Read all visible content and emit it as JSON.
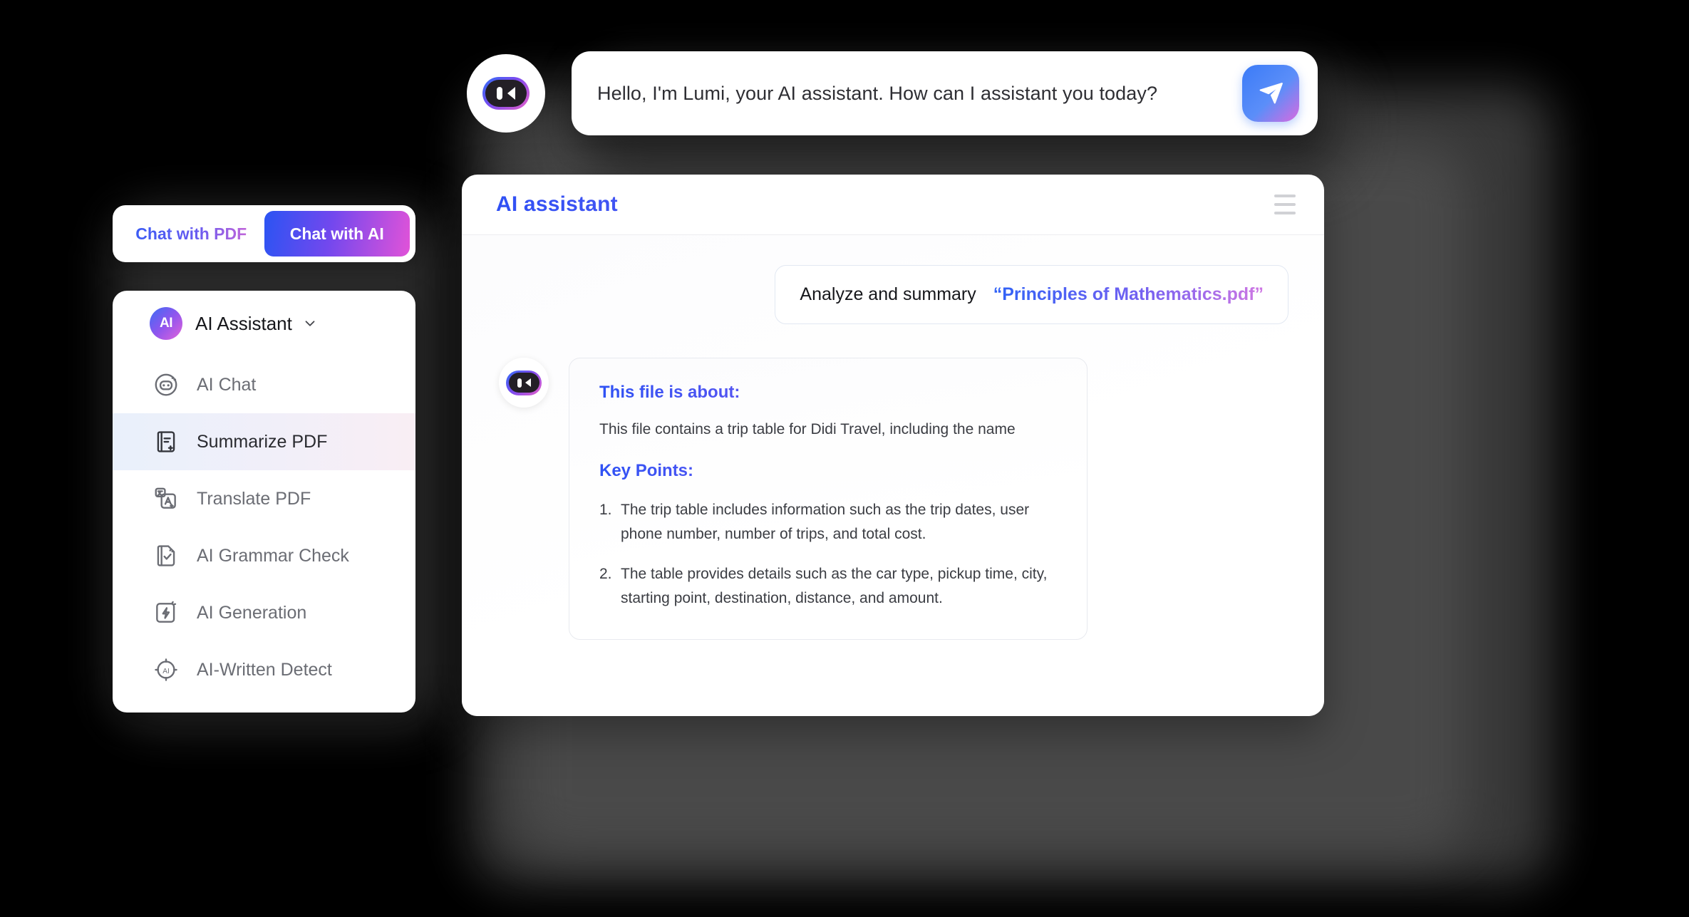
{
  "greeting": {
    "avatar_icon": "bot-face-icon",
    "message": "Hello, I'm Lumi, your AI assistant. How can I assistant you today?",
    "send_icon": "paper-plane-send-icon"
  },
  "tabs": [
    {
      "label": "Chat with PDF",
      "active": false
    },
    {
      "label": "Chat with AI",
      "active": true
    }
  ],
  "sidebar": {
    "header": {
      "avatar_text": "AI",
      "label": "AI Assistant",
      "chevron_icon": "chevron-down-icon"
    },
    "items": [
      {
        "label": "AI Chat",
        "icon": "robot-face-icon",
        "active": false
      },
      {
        "label": "Summarize PDF",
        "icon": "document-lines-icon",
        "active": true
      },
      {
        "label": "Translate PDF",
        "icon": "translate-card-icon",
        "active": false
      },
      {
        "label": "AI Grammar Check",
        "icon": "document-check-icon",
        "active": false
      },
      {
        "label": "AI Generation",
        "icon": "lightning-bolt-icon",
        "active": false
      },
      {
        "label": "AI-Written Detect",
        "icon": "ai-target-icon",
        "active": false
      }
    ]
  },
  "main": {
    "title": "AI assistant",
    "menu_icon": "hamburger-menu-icon",
    "user_message": {
      "prefix": "Analyze and summary",
      "filename": "“Principles of Mathematics.pdf”"
    },
    "response": {
      "avatar_icon": "bot-face-icon",
      "about_heading": "This file is about:",
      "about_text": "This file contains a trip table for Didi Travel, including the name",
      "key_points_heading": "Key Points:",
      "points": [
        {
          "num": "1.",
          "text": "The trip table includes information such as the trip dates, user phone number, number of trips, and total cost."
        },
        {
          "num": "2.",
          "text": "The table provides details such as the car type, pickup time, city, starting point, destination, distance, and amount."
        }
      ]
    }
  },
  "colors": {
    "gradient_blue": "#2f52f4",
    "gradient_purple": "#7157f0",
    "gradient_pink": "#e153d8",
    "page_background": "#000000",
    "card_background": "#ffffff",
    "active_row_start": "#e9f0fb",
    "active_row_end": "#f9eef4"
  }
}
